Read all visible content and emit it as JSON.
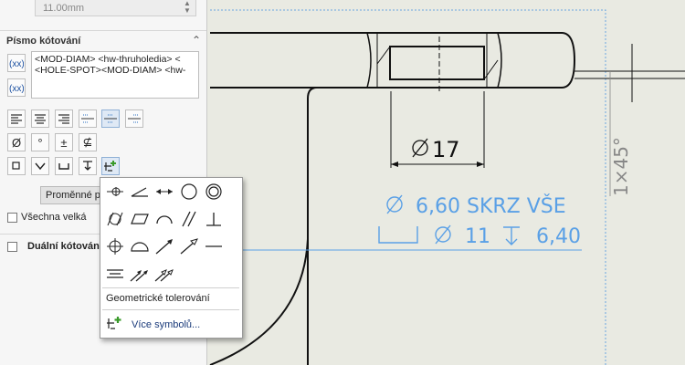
{
  "panel": {
    "top_field_value": "11.00mm",
    "section_title": "Písmo kótování",
    "text_lines": [
      "<MOD-DIAM> <hw-thruholedia> <",
      "<HOLE-SPOT><MOD-DIAM> <hw-"
    ],
    "variables_button": "Proměnné p",
    "all_caps_label": "Všechna velká",
    "dual_label": "Duální kótován",
    "symbol_row_glyphs": [
      "Ø",
      "°",
      "±",
      "⊈"
    ]
  },
  "popup": {
    "tooltip_label": "Geometrické tolerování",
    "more_symbols_label": "Více symbolů..."
  },
  "drawing": {
    "dim_diameter": "17",
    "callout_line1": "6,60 SKRZ VŠE",
    "callout_line2_diam": "11",
    "callout_line2_depth": "6,40",
    "chamfer_label": "1×45°",
    "accent_color": "#5aa0e6"
  }
}
